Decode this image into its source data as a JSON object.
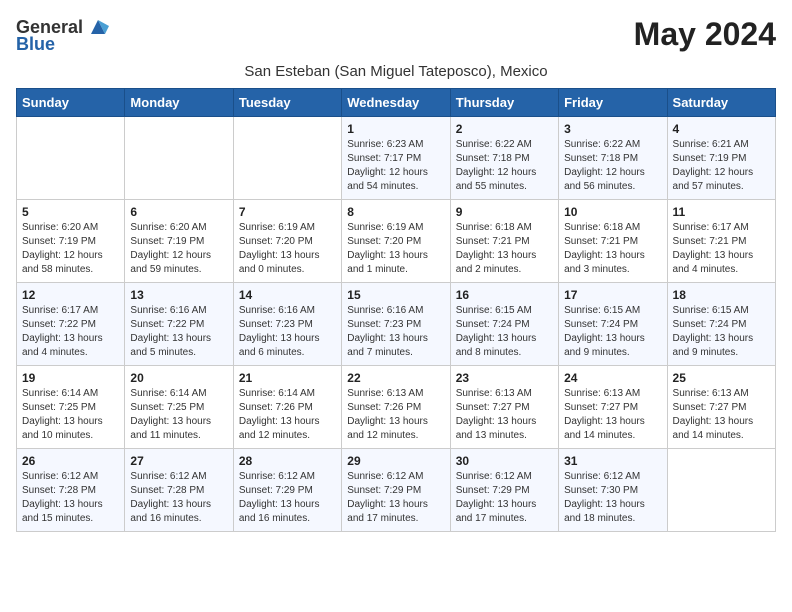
{
  "logo": {
    "general": "General",
    "blue": "Blue"
  },
  "month_title": "May 2024",
  "subtitle": "San Esteban (San Miguel Tateposco), Mexico",
  "days_header": [
    "Sunday",
    "Monday",
    "Tuesday",
    "Wednesday",
    "Thursday",
    "Friday",
    "Saturday"
  ],
  "weeks": [
    [
      {
        "day": "",
        "info": ""
      },
      {
        "day": "",
        "info": ""
      },
      {
        "day": "",
        "info": ""
      },
      {
        "day": "1",
        "info": "Sunrise: 6:23 AM\nSunset: 7:17 PM\nDaylight: 12 hours\nand 54 minutes."
      },
      {
        "day": "2",
        "info": "Sunrise: 6:22 AM\nSunset: 7:18 PM\nDaylight: 12 hours\nand 55 minutes."
      },
      {
        "day": "3",
        "info": "Sunrise: 6:22 AM\nSunset: 7:18 PM\nDaylight: 12 hours\nand 56 minutes."
      },
      {
        "day": "4",
        "info": "Sunrise: 6:21 AM\nSunset: 7:19 PM\nDaylight: 12 hours\nand 57 minutes."
      }
    ],
    [
      {
        "day": "5",
        "info": "Sunrise: 6:20 AM\nSunset: 7:19 PM\nDaylight: 12 hours\nand 58 minutes."
      },
      {
        "day": "6",
        "info": "Sunrise: 6:20 AM\nSunset: 7:19 PM\nDaylight: 12 hours\nand 59 minutes."
      },
      {
        "day": "7",
        "info": "Sunrise: 6:19 AM\nSunset: 7:20 PM\nDaylight: 13 hours\nand 0 minutes."
      },
      {
        "day": "8",
        "info": "Sunrise: 6:19 AM\nSunset: 7:20 PM\nDaylight: 13 hours\nand 1 minute."
      },
      {
        "day": "9",
        "info": "Sunrise: 6:18 AM\nSunset: 7:21 PM\nDaylight: 13 hours\nand 2 minutes."
      },
      {
        "day": "10",
        "info": "Sunrise: 6:18 AM\nSunset: 7:21 PM\nDaylight: 13 hours\nand 3 minutes."
      },
      {
        "day": "11",
        "info": "Sunrise: 6:17 AM\nSunset: 7:21 PM\nDaylight: 13 hours\nand 4 minutes."
      }
    ],
    [
      {
        "day": "12",
        "info": "Sunrise: 6:17 AM\nSunset: 7:22 PM\nDaylight: 13 hours\nand 4 minutes."
      },
      {
        "day": "13",
        "info": "Sunrise: 6:16 AM\nSunset: 7:22 PM\nDaylight: 13 hours\nand 5 minutes."
      },
      {
        "day": "14",
        "info": "Sunrise: 6:16 AM\nSunset: 7:23 PM\nDaylight: 13 hours\nand 6 minutes."
      },
      {
        "day": "15",
        "info": "Sunrise: 6:16 AM\nSunset: 7:23 PM\nDaylight: 13 hours\nand 7 minutes."
      },
      {
        "day": "16",
        "info": "Sunrise: 6:15 AM\nSunset: 7:24 PM\nDaylight: 13 hours\nand 8 minutes."
      },
      {
        "day": "17",
        "info": "Sunrise: 6:15 AM\nSunset: 7:24 PM\nDaylight: 13 hours\nand 9 minutes."
      },
      {
        "day": "18",
        "info": "Sunrise: 6:15 AM\nSunset: 7:24 PM\nDaylight: 13 hours\nand 9 minutes."
      }
    ],
    [
      {
        "day": "19",
        "info": "Sunrise: 6:14 AM\nSunset: 7:25 PM\nDaylight: 13 hours\nand 10 minutes."
      },
      {
        "day": "20",
        "info": "Sunrise: 6:14 AM\nSunset: 7:25 PM\nDaylight: 13 hours\nand 11 minutes."
      },
      {
        "day": "21",
        "info": "Sunrise: 6:14 AM\nSunset: 7:26 PM\nDaylight: 13 hours\nand 12 minutes."
      },
      {
        "day": "22",
        "info": "Sunrise: 6:13 AM\nSunset: 7:26 PM\nDaylight: 13 hours\nand 12 minutes."
      },
      {
        "day": "23",
        "info": "Sunrise: 6:13 AM\nSunset: 7:27 PM\nDaylight: 13 hours\nand 13 minutes."
      },
      {
        "day": "24",
        "info": "Sunrise: 6:13 AM\nSunset: 7:27 PM\nDaylight: 13 hours\nand 14 minutes."
      },
      {
        "day": "25",
        "info": "Sunrise: 6:13 AM\nSunset: 7:27 PM\nDaylight: 13 hours\nand 14 minutes."
      }
    ],
    [
      {
        "day": "26",
        "info": "Sunrise: 6:12 AM\nSunset: 7:28 PM\nDaylight: 13 hours\nand 15 minutes."
      },
      {
        "day": "27",
        "info": "Sunrise: 6:12 AM\nSunset: 7:28 PM\nDaylight: 13 hours\nand 16 minutes."
      },
      {
        "day": "28",
        "info": "Sunrise: 6:12 AM\nSunset: 7:29 PM\nDaylight: 13 hours\nand 16 minutes."
      },
      {
        "day": "29",
        "info": "Sunrise: 6:12 AM\nSunset: 7:29 PM\nDaylight: 13 hours\nand 17 minutes."
      },
      {
        "day": "30",
        "info": "Sunrise: 6:12 AM\nSunset: 7:29 PM\nDaylight: 13 hours\nand 17 minutes."
      },
      {
        "day": "31",
        "info": "Sunrise: 6:12 AM\nSunset: 7:30 PM\nDaylight: 13 hours\nand 18 minutes."
      },
      {
        "day": "",
        "info": ""
      }
    ]
  ]
}
